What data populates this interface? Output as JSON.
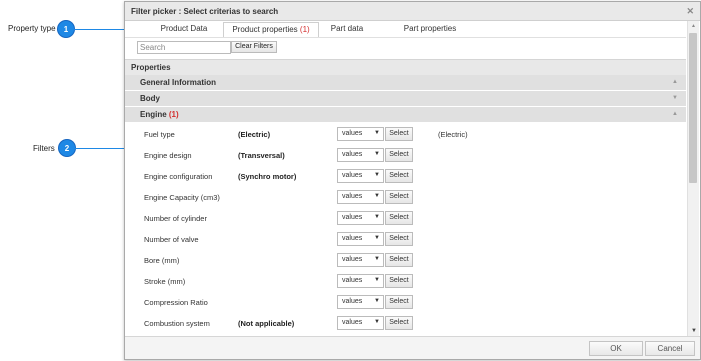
{
  "annotations": [
    {
      "label": "Property type",
      "badge": "1"
    },
    {
      "label": "Filters",
      "badge": "2"
    }
  ],
  "dialog": {
    "title": "Filter picker : Select criterias to search",
    "close_icon": "close-icon"
  },
  "tabs": [
    {
      "label": "Product Data",
      "count": ""
    },
    {
      "label": "Product properties ",
      "count": "(1)"
    },
    {
      "label": "Part data",
      "count": ""
    },
    {
      "label": "Part properties",
      "count": ""
    }
  ],
  "toolbar": {
    "search_placeholder": "Search",
    "clear_label": "Clear Filters"
  },
  "properties_header": "Properties",
  "sections": [
    {
      "label": "General Information",
      "count": "",
      "arrow": "▲"
    },
    {
      "label": "Body",
      "count": "",
      "arrow": "▼"
    },
    {
      "label": "Engine ",
      "count": "(1)",
      "arrow": "▲"
    }
  ],
  "rows": [
    {
      "name": "Fuel type",
      "value": "(Electric)",
      "select": "values",
      "button": "Select",
      "result": "(Electric)"
    },
    {
      "name": "Engine design",
      "value": "(Transversal)",
      "select": "values",
      "button": "Select",
      "result": ""
    },
    {
      "name": "Engine configuration",
      "value": "(Synchro motor)",
      "select": "values",
      "button": "Select",
      "result": ""
    },
    {
      "name": "Engine Capacity (cm3)",
      "value": "",
      "select": "values",
      "button": "Select",
      "result": ""
    },
    {
      "name": "Number of cylinder",
      "value": "",
      "select": "values",
      "button": "Select",
      "result": ""
    },
    {
      "name": "Number of valve",
      "value": "",
      "select": "values",
      "button": "Select",
      "result": ""
    },
    {
      "name": "Bore (mm)",
      "value": "",
      "select": "values",
      "button": "Select",
      "result": ""
    },
    {
      "name": "Stroke (mm)",
      "value": "",
      "select": "values",
      "button": "Select",
      "result": ""
    },
    {
      "name": "Compression Ratio",
      "value": "",
      "select": "values",
      "button": "Select",
      "result": ""
    },
    {
      "name": "Combustion system",
      "value": "(Not applicable)",
      "select": "values",
      "button": "Select",
      "result": ""
    }
  ],
  "footer": {
    "ok_label": "OK",
    "cancel_label": "Cancel"
  },
  "colors": {
    "accent": "#1e88e5",
    "count_red": "#d32f2f"
  }
}
